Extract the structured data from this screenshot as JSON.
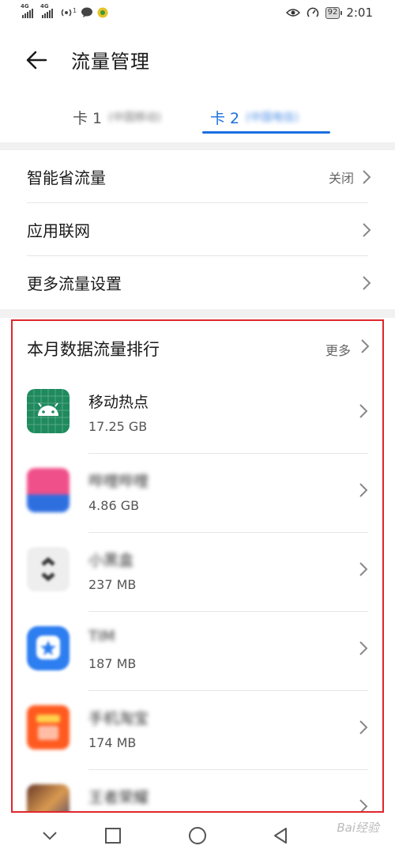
{
  "status_bar": {
    "sim1_net": "4G",
    "sim2_net": "4G",
    "hotspot_count": "1",
    "battery": "92",
    "time": "2:01"
  },
  "header": {
    "title": "流量管理"
  },
  "tabs": [
    {
      "label": "卡 1",
      "carrier": "(中国移动)",
      "selected": false
    },
    {
      "label": "卡 2",
      "carrier": "(中国电信)",
      "selected": true
    }
  ],
  "settings": [
    {
      "label": "智能省流量",
      "value": "关闭"
    },
    {
      "label": "应用联网",
      "value": ""
    },
    {
      "label": "更多流量设置",
      "value": ""
    }
  ],
  "ranking": {
    "title": "本月数据流量排行",
    "more": "更多",
    "apps": [
      {
        "name": "移动热点",
        "usage": "17.25 GB",
        "icon": "android-hotspot-icon"
      },
      {
        "name": "哔哩哔哩",
        "usage": "4.86 GB",
        "icon": "bilibili-icon"
      },
      {
        "name": "小黑盒",
        "usage": "237 MB",
        "icon": "xiaoheihe-icon"
      },
      {
        "name": "TIM",
        "usage": "187 MB",
        "icon": "tim-icon"
      },
      {
        "name": "手机淘宝",
        "usage": "174 MB",
        "icon": "taobao-icon"
      },
      {
        "name": "王者荣耀",
        "usage": "",
        "icon": "wzry-icon"
      }
    ]
  },
  "colors": {
    "accent": "#1a6fe0",
    "highlight_border": "#e0262b",
    "hotspot_icon_bg": "#1f8a5e"
  },
  "watermark": "Bai经验"
}
